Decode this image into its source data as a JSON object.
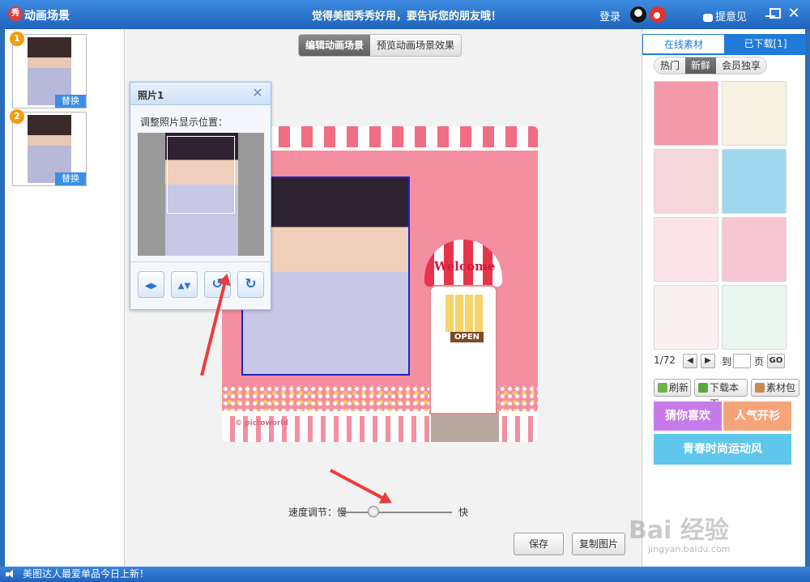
{
  "titlebar": {
    "app_logo": "秀",
    "title": "动画场景",
    "slogan": "觉得美图秀秀好用，要告诉您的朋友哦！",
    "login": "登录",
    "feedback": "提意见"
  },
  "left_panel": {
    "thumbnails": [
      {
        "index": "1",
        "replace_label": "替换"
      },
      {
        "index": "2",
        "replace_label": "替换"
      }
    ]
  },
  "center": {
    "tabs": [
      {
        "label": "编辑动画场景",
        "active": true
      },
      {
        "label": "预览动画场景效果",
        "active": false
      }
    ],
    "canvas": {
      "welcome_text": "Welcome",
      "open_sign": "OPEN",
      "brand": "© pictoworld"
    },
    "speed": {
      "label": "速度调节：慢",
      "fast_label": "快"
    },
    "buttons": {
      "save": "保存",
      "copy": "复制图片"
    }
  },
  "popup": {
    "title": "照片1",
    "close": "✕",
    "label": "调整照片显示位置：",
    "tools": [
      {
        "name": "flip-horizontal-icon",
        "glyph": "◀▶"
      },
      {
        "name": "flip-vertical-icon",
        "glyph": "▲▼"
      },
      {
        "name": "rotate-left-icon",
        "glyph": "↺"
      },
      {
        "name": "rotate-right-icon",
        "glyph": "↻"
      }
    ]
  },
  "right_panel": {
    "tabs": [
      {
        "label": "在线素材",
        "active": true
      },
      {
        "label": "已下载[1]",
        "active": false
      }
    ],
    "subtabs": [
      {
        "label": "热门",
        "active": false
      },
      {
        "label": "新鲜",
        "active": true
      },
      {
        "label": "会员独享",
        "active": false
      }
    ],
    "tiles": [
      "#f39aaa",
      "#f7f1e2",
      "#f5d7dc",
      "#9fd8ee",
      "#fbe3e9",
      "#f7c6d4",
      "#fdf0f3",
      "#e9f6ef"
    ],
    "pager": {
      "page": "1/72",
      "prev": "◀",
      "next": "▶",
      "to": "到",
      "page_unit": "页",
      "go": "GO"
    },
    "actions": {
      "refresh": "刷新",
      "download_page": "下载本页",
      "material_pack": "素材包"
    },
    "promos": [
      {
        "label": "猜你喜欢",
        "color": "#c77be8"
      },
      {
        "label": "人气开衫",
        "color": "#f6a57a"
      },
      {
        "label": "青春时尚运动风",
        "color": "#5fc6ec"
      }
    ]
  },
  "statusbar": {
    "text": "美图达人最爱单品今日上新！"
  },
  "watermark": {
    "text": "Bai 经验",
    "sub": "jingyan.baidu.com"
  },
  "colors": {
    "accent": "#1f7ad8",
    "canvas_bg": "#f38fa0",
    "annotation_arrow": "#ee3b3b"
  }
}
